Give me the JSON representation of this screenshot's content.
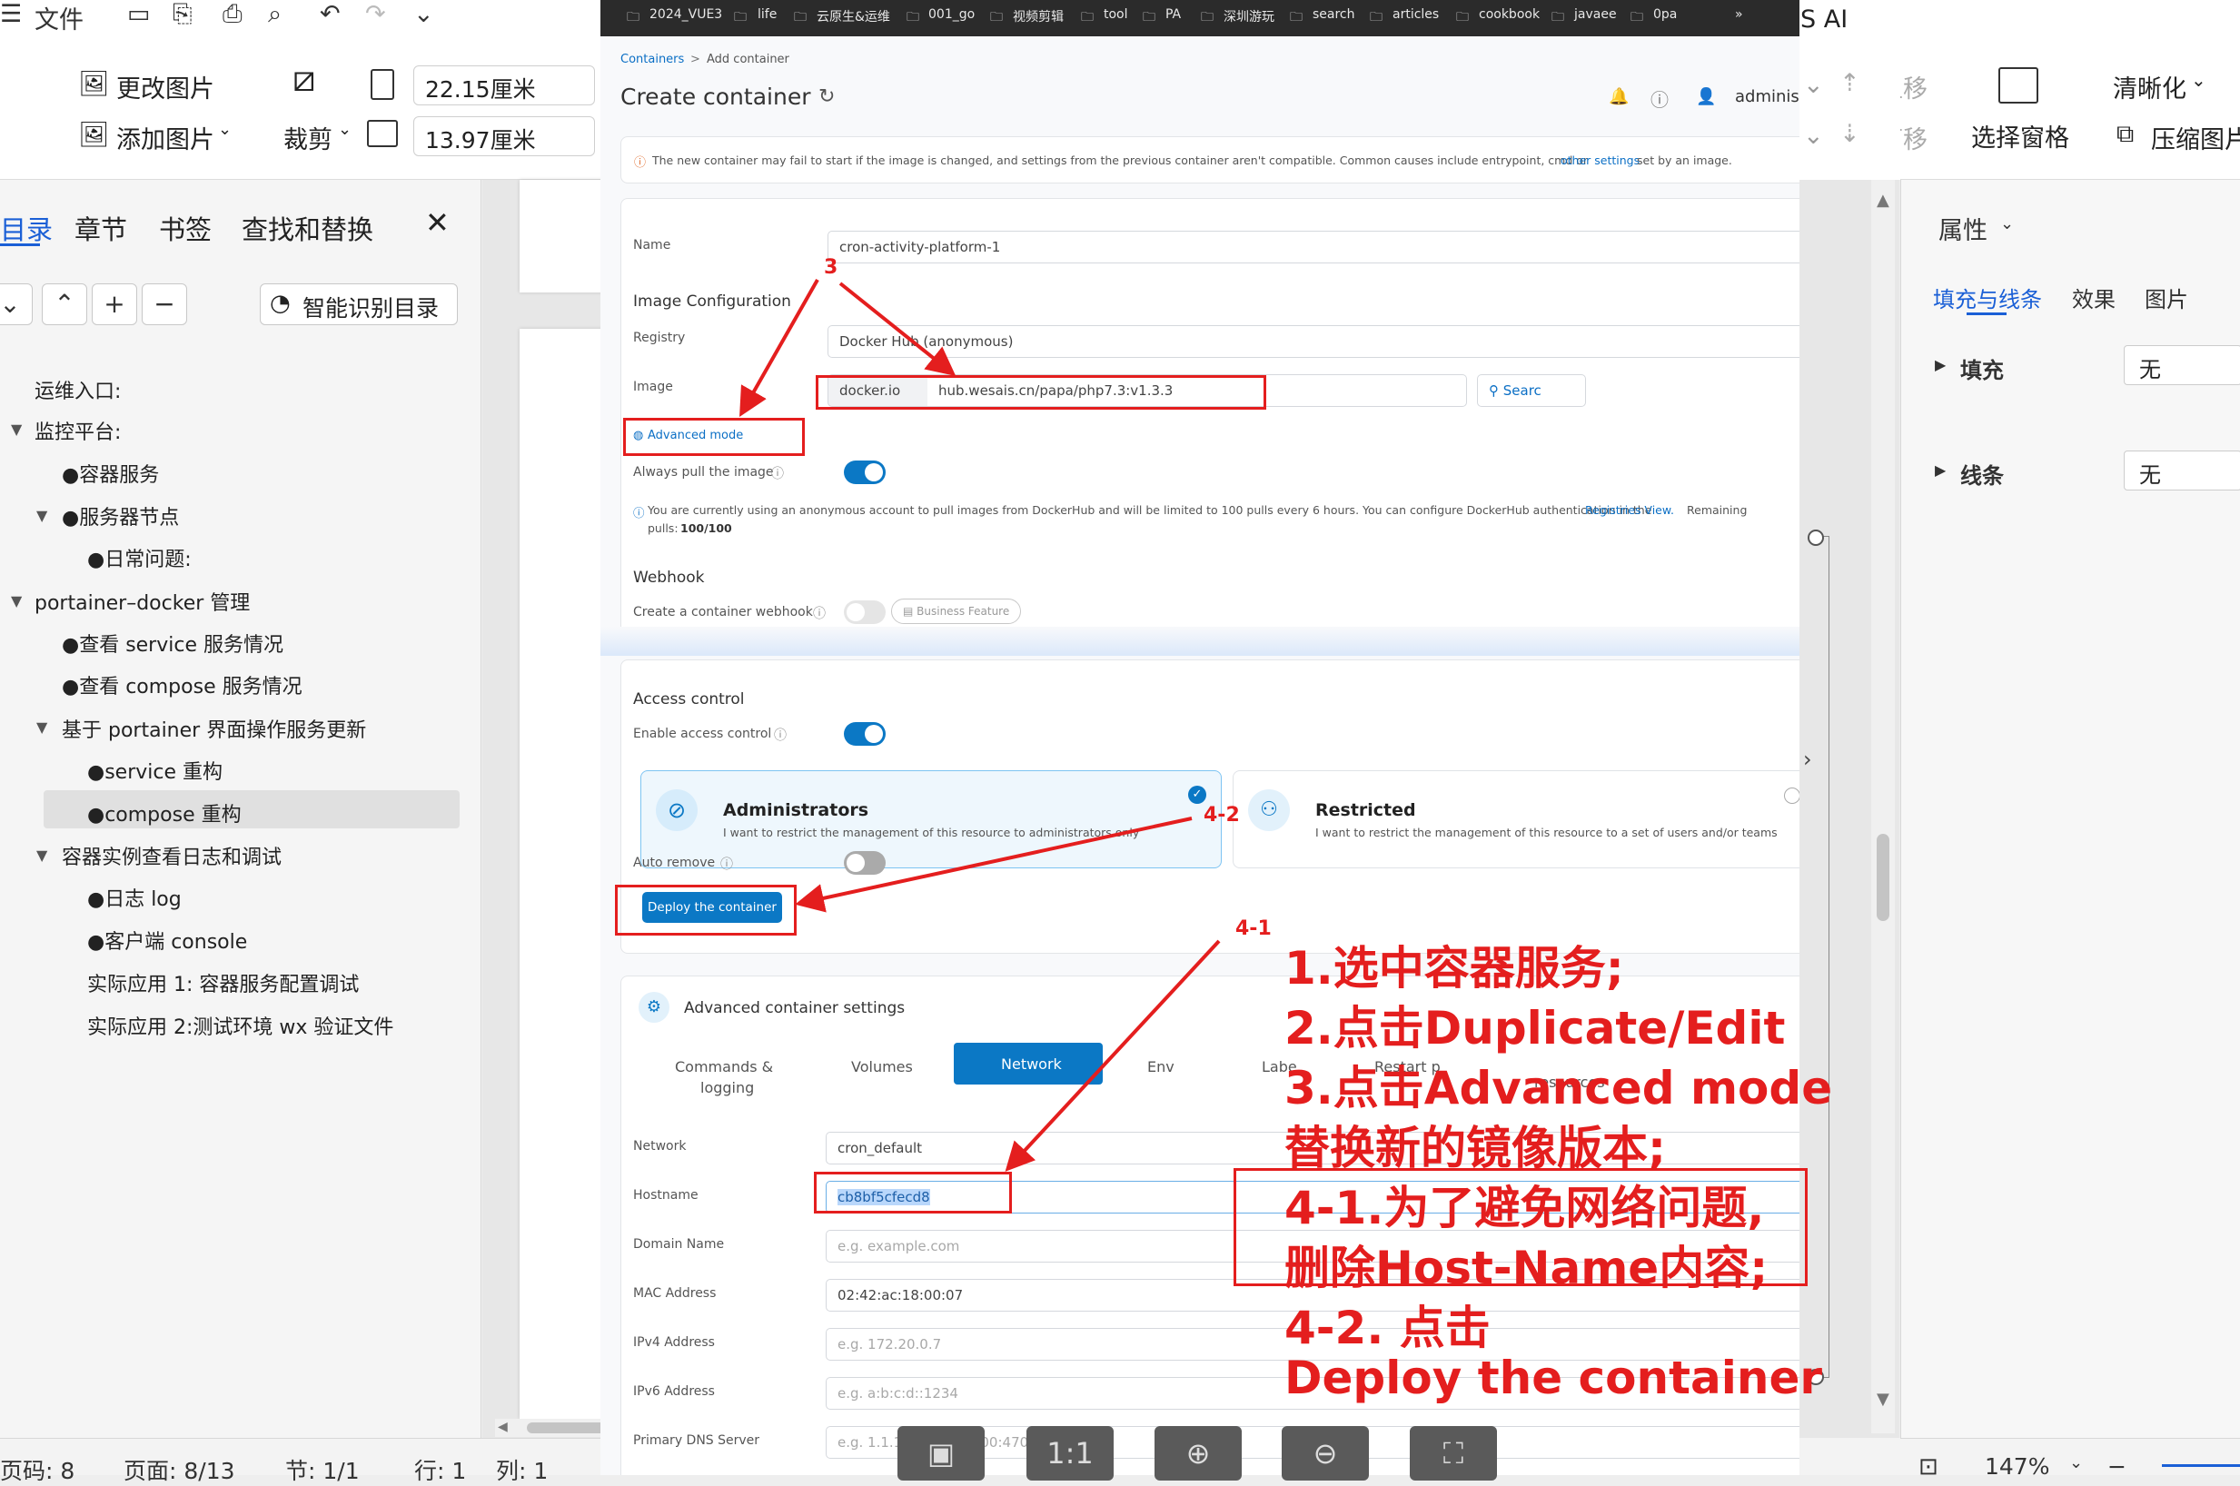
{
  "wps": {
    "menu": {
      "file": "文件"
    },
    "toolbar": {
      "change_image": "更改图片",
      "add_image": "添加图片",
      "crop": "裁剪",
      "width_value": "22.15厘米",
      "height_value": "13.97厘米",
      "move_up": "上移",
      "move_down": "下移",
      "select_pane": "选择窗格",
      "sharpen": "清晰化",
      "compress": "压缩图片",
      "top_right_text": "S AI"
    },
    "left_panel": {
      "tabs": [
        "目录",
        "章节",
        "书签",
        "查找和替换"
      ],
      "smart_toc": "智能识别目录",
      "toc_items": [
        "运维入口:",
        "监控平台:",
        "●容器服务",
        "●服务器节点",
        "●日常问题:",
        "portainer–docker 管理",
        "●查看 service 服务情况",
        "●查看 compose 服务情况",
        "基于 portainer 界面操作服务更新",
        "●service 重构",
        "●compose 重构",
        "容器实例查看日志和调试",
        "●日志 log",
        "●客户端 console",
        "实际应用 1: 容器服务配置调试",
        "实际应用 2:测试环境 wx 验证文件"
      ]
    },
    "right_panel": {
      "title": "属性",
      "tabs": [
        "填充与线条",
        "效果",
        "图片"
      ],
      "fill_label": "填充",
      "fill_value": "无",
      "line_label": "线条",
      "line_value": "无"
    },
    "status": {
      "page_num": "页码: 8",
      "page_of": "页面: 8/13",
      "section": "节: 1/1",
      "row": "行: 1",
      "col": "列: 1",
      "zoom": "147%"
    },
    "viewer": {
      "one_to_one": "1:1"
    }
  },
  "browser": {
    "bookmarks": [
      "2024_VUE3",
      "life",
      "云原生&运维",
      "001_go",
      "视频剪辑",
      "tool",
      "PA",
      "深圳游玩",
      "search",
      "articles",
      "cookbook",
      "javaee",
      "0pa"
    ],
    "more": "»"
  },
  "portainer": {
    "breadcrumb_root": "Containers",
    "breadcrumb_sep": ">",
    "breadcrumb_current": "Add container",
    "page_title": "Create container",
    "user": "adminis",
    "warning": "The new container may fail to start if the image is changed, and settings from the previous container aren't compatible. Common causes include entrypoint, cmd or",
    "warning_link": "other settings",
    "warning_tail": "set by an image.",
    "name_label": "Name",
    "name_value": "cron-activity-platform-1",
    "image_config": "Image Configuration",
    "registry_label": "Registry",
    "registry_value": "Docker Hub (anonymous)",
    "image_label": "Image",
    "image_prefix": "docker.io",
    "image_value": "hub.wesais.cn/papa/php7.3:v1.3.3",
    "search_btn": "Searc",
    "advanced_mode": "Advanced mode",
    "always_pull": "Always pull the image",
    "dockerhub_info": "You are currently using an anonymous account to pull images from DockerHub and will be limited to 100 pulls every 6 hours. You can configure DockerHub authentication in the",
    "registries_link": "Registries View.",
    "remaining": "Remaining",
    "pulls_label": "pulls:",
    "pulls_value": "100/100",
    "webhook_title": "Webhook",
    "webhook_label": "Create a container webhook",
    "business_feature": "Business Feature",
    "access_title": "Access control",
    "enable_access": "Enable access control",
    "admin_title": "Administrators",
    "admin_desc": "I want to restrict the management of this resource to administrators only",
    "restricted_title": "Restricted",
    "restricted_desc": "I want to restrict the management of this resource to a set of users and/or teams",
    "auto_remove": "Auto remove",
    "deploy_btn": "Deploy the container",
    "advanced_settings": "Advanced container settings",
    "tabs": [
      "Commands &",
      "logging",
      "Volumes",
      "Network",
      "Env",
      "Labe",
      "Restart p",
      "resources"
    ],
    "network_label": "Network",
    "network_value": "cron_default",
    "hostname_label": "Hostname",
    "hostname_value": "cb8bf5cfecd8",
    "domain_label": "Domain Name",
    "domain_ph": "e.g. example.com",
    "mac_label": "MAC Address",
    "mac_value": "02:42:ac:18:00:07",
    "ipv4_label": "IPv4 Address",
    "ipv4_ph": "e.g. 172.20.0.7",
    "ipv6_label": "IPv6 Address",
    "ipv6_ph": "e.g. a:b:c:d::1234",
    "dns_label": "Primary DNS Server",
    "dns_ph": "e.g. 1.1.1.1, 2606:4700:4700::1111"
  },
  "annotations": {
    "num3": "3",
    "num42": "4-2",
    "num41": "4-1",
    "lines": [
      "1.选中容器服务;",
      "2.点击Duplicate/Edit",
      "3.点击Advanced mode",
      "替换新的镜像版本;",
      "4-1.为了避免网络问题,",
      "删除Host-Name内容;",
      "4-2. 点击",
      "Deploy the container"
    ],
    "color": "#e41e1e"
  }
}
